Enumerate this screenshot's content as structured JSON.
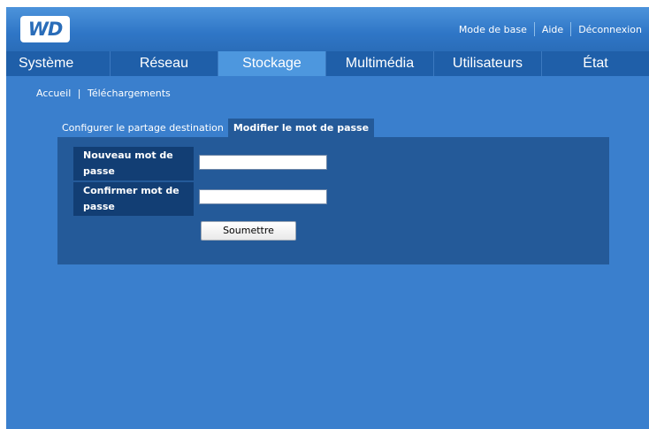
{
  "header": {
    "logo_text": "WD",
    "links": [
      "Mode de base",
      "Aide",
      "Déconnexion"
    ]
  },
  "nav": {
    "tabs": [
      "Système",
      "Réseau",
      "Stockage",
      "Multimédia",
      "Utilisateurs",
      "État"
    ],
    "active": "Stockage"
  },
  "breadcrumb": {
    "home": "Accueil",
    "separator": "|",
    "current": "Téléchargements"
  },
  "subtabs": {
    "items": [
      "Configurer le partage destination",
      "Modifier le mot de passe"
    ],
    "active": "Modifier le mot de passe"
  },
  "form": {
    "new_password_label": "Nouveau mot de passe",
    "confirm_password_label": "Confirmer mot de passe",
    "new_password_value": "",
    "confirm_password_value": "",
    "submit_label": "Soumettre"
  },
  "colors": {
    "background": "#3a7fcd",
    "nav_bar": "#1f5fa9",
    "active_tab": "#4d97de",
    "panel": "#245a99",
    "label_bg": "#123e74"
  }
}
